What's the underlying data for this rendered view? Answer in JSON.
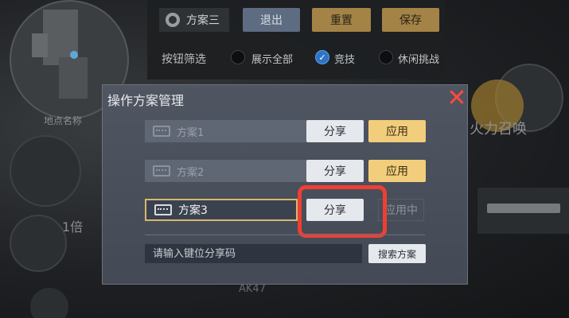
{
  "background": {
    "map_label": "地点名称",
    "scope_label": "1倍",
    "fire_label": "火力召唤",
    "weapon_label": "AK47"
  },
  "topbar": {
    "scheme_name": "方案三",
    "exit_label": "退出",
    "reset_label": "重置",
    "save_label": "保存",
    "filter_label": "按钮筛选",
    "filters": [
      {
        "label": "展示全部",
        "checked": false
      },
      {
        "label": "竞技",
        "checked": true
      },
      {
        "label": "休闲挑战",
        "checked": false
      }
    ]
  },
  "dialog": {
    "title": "操作方案管理",
    "close_symbol": "✕",
    "schemes": [
      {
        "name": "方案1",
        "share_label": "分享",
        "apply_label": "应用",
        "state": "available"
      },
      {
        "name": "方案2",
        "share_label": "分享",
        "apply_label": "应用",
        "state": "available"
      },
      {
        "name": "方案3",
        "share_label": "分享",
        "apply_label": "应用中",
        "state": "active"
      }
    ],
    "share_code_placeholder": "请输入键位分享码",
    "search_label": "搜索方案"
  },
  "colors": {
    "highlight": "#ef3f33",
    "apply_gold": "#f2cd7b",
    "active_border": "#d8b770",
    "checked_radio": "#2f74c4"
  }
}
